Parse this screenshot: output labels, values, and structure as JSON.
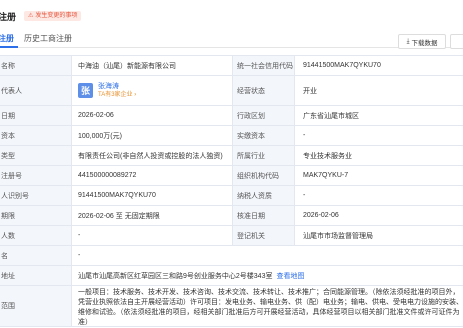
{
  "header": {
    "title": "注册",
    "badge": "发生变更的事项",
    "tabs": [
      "注册",
      "历史工商注册"
    ],
    "download_label": "下载数据"
  },
  "rows": [
    {
      "l1": "名称",
      "v1": "中海油（汕尾）新能源有限公司",
      "l2": "统一社会信用代码",
      "v2": "91441500MAK7QYKU70"
    },
    {
      "l1": "代表人",
      "rep_avatar": "张",
      "rep_name": "张海涛",
      "rep_sub": "TA有3家企业 ›",
      "l2": "经营状态",
      "v2": "开业"
    },
    {
      "l1": "日期",
      "v1": "2026-02-06",
      "l2": "行政区划",
      "v2": "广东省汕尾市城区"
    },
    {
      "l1": "资本",
      "v1": "100,000万(元)",
      "l2": "实缴资本",
      "v2": "-"
    },
    {
      "l1": "类型",
      "v1": "有限责任公司(非自然人投资或控股的法人独资)",
      "l2": "所属行业",
      "v2": "专业技术服务业"
    },
    {
      "l1": "注册号",
      "v1": "441500000089272",
      "l2": "组织机构代码",
      "v2": "MAK7QYKU-7"
    },
    {
      "l1": "人识别号",
      "v1": "91441500MAK7QYKU70",
      "l2": "纳税人资质",
      "v2": "-"
    },
    {
      "l1": "期限",
      "v1": "2026-02-06 至 无固定期限",
      "l2": "核准日期",
      "v2": "2026-02-06"
    },
    {
      "l1": "人数",
      "v1": "-",
      "l2": "登记机关",
      "v2": "汕尾市市场监督管理局"
    },
    {
      "l1": "名",
      "v1": "-"
    },
    {
      "l1": "地址",
      "v1": "汕尾市汕尾高新区红草园区三和路9号创业服务中心2号楼343室",
      "v1_link": "查看地图"
    },
    {
      "l1": "范围",
      "v1": "一般项目：技术服务、技术开发、技术咨询、技术交流、技术转让、技术推广；合同能源管理。（除依法须经批准的项目外，凭营业执照依法自主开展经营活动）许可项目：发电业务、输电业务、供（配）电业务；输电、供电、受电电力设施的安装、维修和试验。（依法须经批准的项目，经相关部门批准后方可开展经营活动，具体经营项目以相关部门批准文件或许可证件为准）"
    }
  ]
}
